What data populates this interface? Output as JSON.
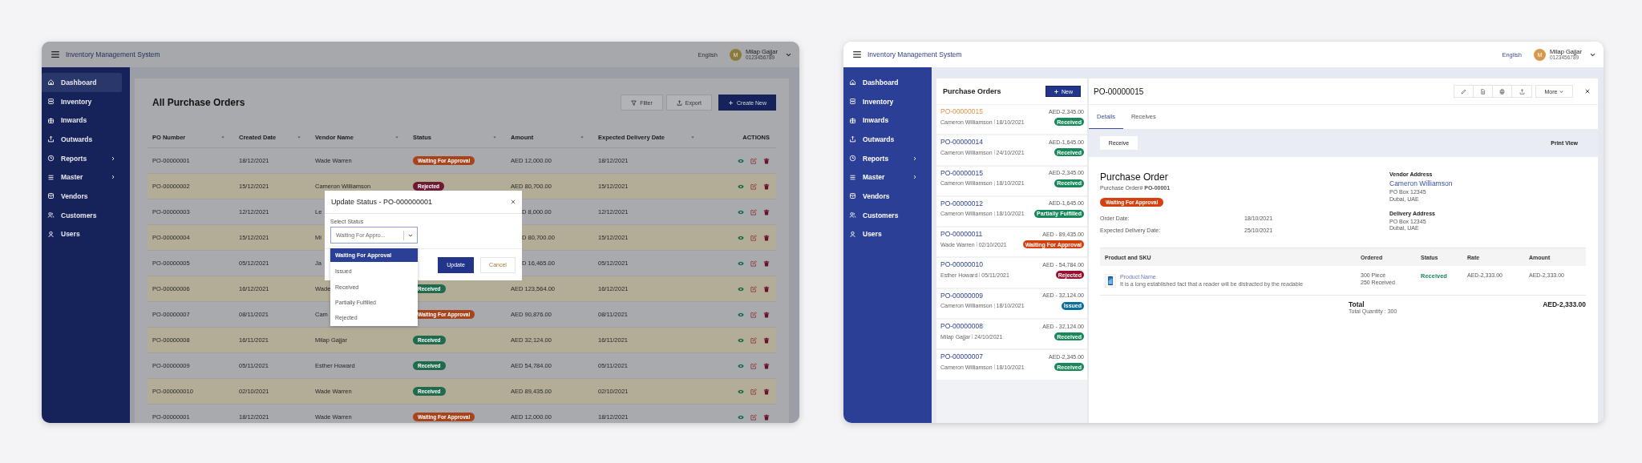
{
  "left_screen": {
    "header": {
      "app_title": "Inventory Management System",
      "language": "English",
      "user": {
        "initial": "M",
        "name": "Milap Gajjar",
        "phone": "0123456789"
      }
    },
    "sidebar": {
      "items": [
        {
          "label": "Dashboard",
          "kind": "home",
          "selected": true,
          "has_submenu": false
        },
        {
          "label": "Inventory",
          "kind": "stack",
          "selected": false,
          "has_submenu": false
        },
        {
          "label": "Inwards",
          "kind": "package",
          "selected": false,
          "has_submenu": false
        },
        {
          "label": "Outwards",
          "kind": "upload",
          "selected": false,
          "has_submenu": false
        },
        {
          "label": "Reports",
          "kind": "clock",
          "selected": false,
          "has_submenu": true
        },
        {
          "label": "Master",
          "kind": "list",
          "selected": false,
          "has_submenu": true
        },
        {
          "label": "Vendors",
          "kind": "store",
          "selected": false,
          "has_submenu": false
        },
        {
          "label": "Customers",
          "kind": "users",
          "selected": false,
          "has_submenu": false
        },
        {
          "label": "Users",
          "kind": "user",
          "selected": false,
          "has_submenu": false
        }
      ]
    },
    "page_title": "All Purchase Orders",
    "buttons": [
      {
        "label": "Filter",
        "kind": "filter"
      },
      {
        "label": "Export",
        "kind": "export"
      },
      {
        "label": "Create New",
        "kind": "create"
      }
    ],
    "table": {
      "columns": [
        {
          "label": "PO Number",
          "sortable": true
        },
        {
          "label": "Created Date",
          "sortable": true
        },
        {
          "label": "Vendor Name",
          "sortable": true
        },
        {
          "label": "Status",
          "sortable": true
        },
        {
          "label": "Amount",
          "sortable": true
        },
        {
          "label": "Expected Delivery Date",
          "sortable": true
        },
        {
          "label": "ACTIONS",
          "sortable": false
        }
      ],
      "rows": [
        {
          "po_number": "PO-00000001",
          "created_date": "18/12/2021",
          "vendor": "Wade Warren",
          "status": {
            "label": "Waiting For Approval",
            "color": "#a8431c"
          },
          "amount": "AED 12,000.00",
          "expected_date": "18/12/2021"
        },
        {
          "po_number": "PO-00000002",
          "created_date": "15/12/2021",
          "vendor": "Cameron Williamson",
          "status": {
            "label": "Rejected",
            "color": "#6e1a32"
          },
          "amount": "AED 80,700.00",
          "expected_date": "15/12/2021"
        },
        {
          "po_number": "PO-00000003",
          "created_date": "12/12/2021",
          "vendor": "Le",
          "amount": "D 8,000.00",
          "expected_date": "12/12/2021"
        },
        {
          "po_number": "PO-00000004",
          "created_date": "15/12/2021",
          "vendor": "Mi",
          "amount": "D 80,700.00",
          "expected_date": "15/12/2021"
        },
        {
          "po_number": "PO-00000005",
          "created_date": "05/12/2021",
          "vendor": "Ja",
          "amount": "D 16,465.00",
          "expected_date": "05/12/2021"
        },
        {
          "po_number": "PO-00000006",
          "created_date": "16/12/2021",
          "vendor": "Wade",
          "status": {
            "label": "Received",
            "color": "#1f6b4c"
          },
          "amount": "AED 123,564.00",
          "expected_date": "16/12/2021"
        },
        {
          "po_number": "PO-00000007",
          "created_date": "08/11/2021",
          "vendor": "Cam",
          "status": {
            "label": "Waiting For Approval",
            "color": "#a8431c"
          },
          "amount": "AED 90,876.00",
          "expected_date": "08/11/2021"
        },
        {
          "po_number": "PO-00000008",
          "created_date": "16/11/2021",
          "vendor": "Milap Gajjar",
          "status": {
            "label": "Received",
            "color": "#1f6b4c"
          },
          "amount": "AED 32,124.00",
          "expected_date": "16/11/2021"
        },
        {
          "po_number": "PO-00000009",
          "created_date": "05/11/2021",
          "vendor": "Esther Howard",
          "status": {
            "label": "Received",
            "color": "#1f6b4c"
          },
          "amount": "AED 54,784.00",
          "expected_date": "05/11/2021"
        },
        {
          "po_number": "PO-000000010",
          "created_date": "02/10/2021",
          "vendor": "Wade Warren",
          "status": {
            "label": "Received",
            "color": "#1f6b4c"
          },
          "amount": "AED 89,435.00",
          "expected_date": "02/10/2021"
        },
        {
          "po_number": "PO-00000001",
          "created_date": "18/12/2021",
          "vendor": "Wade Warren",
          "status": {
            "label": "Waiting For Approval",
            "color": "#a8431c"
          },
          "amount": "AED 12,000.00",
          "expected_date": "18/12/2021"
        }
      ]
    },
    "modal": {
      "title": "Update Status - PO-000000001",
      "field_label": "Select Status",
      "select_value": "Waiting For Appro...",
      "options": [
        {
          "label": "Waiting For Approval",
          "selected": true
        },
        {
          "label": "Issued",
          "selected": false
        },
        {
          "label": "Received",
          "selected": false
        },
        {
          "label": "Partially Fulfilled",
          "selected": false
        },
        {
          "label": "Rejected",
          "selected": false
        }
      ],
      "buttons": [
        {
          "label": "Update",
          "kind": "primary"
        },
        {
          "label": "Cancel",
          "kind": "secondary"
        }
      ]
    }
  },
  "right_screen": {
    "header": {
      "app_title": "Inventory Management System",
      "language": "English",
      "user": {
        "initial": "M",
        "name": "Milap Gajjar",
        "phone": "0123456789"
      }
    },
    "sidebar": {
      "items": [
        {
          "label": "Dashboard",
          "kind": "home",
          "selected": false,
          "has_submenu": false
        },
        {
          "label": "Inventory",
          "kind": "stack",
          "selected": false,
          "has_submenu": false
        },
        {
          "label": "Inwards",
          "kind": "package",
          "selected": false,
          "has_submenu": false
        },
        {
          "label": "Outwards",
          "kind": "upload",
          "selected": false,
          "has_submenu": false
        },
        {
          "label": "Reports",
          "kind": "clock",
          "selected": false,
          "has_submenu": true
        },
        {
          "label": "Master",
          "kind": "list",
          "selected": false,
          "has_submenu": true
        },
        {
          "label": "Vendors",
          "kind": "store",
          "selected": false,
          "has_submenu": false
        },
        {
          "label": "Customers",
          "kind": "users",
          "selected": false,
          "has_submenu": false
        },
        {
          "label": "Users",
          "kind": "user",
          "selected": false,
          "has_submenu": false
        }
      ]
    },
    "order_list": {
      "title": "Purchase Orders",
      "new_button": "New",
      "items": [
        {
          "po_number": "PO-00000015",
          "vendor": "Cameron Williamson",
          "date": "18/10/2021",
          "amount": "AED-2,345.00",
          "status": {
            "label": "Received",
            "color": "#18875a"
          },
          "selected": true
        },
        {
          "po_number": "PO-00000014",
          "vendor": "Cameron Williamson",
          "date": "24/10/2021",
          "amount": "AED-1,645.00",
          "status": {
            "label": "Received",
            "color": "#18875a"
          },
          "selected": false
        },
        {
          "po_number": "PO-00000015",
          "vendor": "Cameron Williamson",
          "date": "18/10/2021",
          "amount": "AED-2,345.00",
          "status": {
            "label": "Received",
            "color": "#18875a"
          },
          "selected": false
        },
        {
          "po_number": "PO-00000012",
          "vendor": "Cameron Williamson",
          "date": "18/10/2021",
          "amount": "AED-1,645.00",
          "status": {
            "label": "Partially Fulfilled",
            "color": "#18875a"
          },
          "selected": false
        },
        {
          "po_number": "PO-00000011",
          "vendor": "Wade Warren",
          "date": "02/10/2021",
          "amount": "AED - 89,435.00",
          "status": {
            "label": "Waiting For Approval",
            "color": "#d4400f"
          },
          "selected": false
        },
        {
          "po_number": "PO-00000010",
          "vendor": "Esther Howard",
          "date": "05/11/2021",
          "amount": "AED - 54,784.00",
          "status": {
            "label": "Rejected",
            "color": "#99102e"
          },
          "selected": false
        },
        {
          "po_number": "PO-00000009",
          "vendor": "Cameron Williamson",
          "date": "18/10/2021",
          "amount": "AED - 32,124.00",
          "status": {
            "label": "Issued",
            "color": "#0b6e98"
          },
          "selected": false
        },
        {
          "po_number": "PO-00000008",
          "vendor": "Milap Gajjar",
          "date": "24/10/2021",
          "amount": "AED - 32,124.00",
          "status": {
            "label": "Received",
            "color": "#18875a"
          },
          "selected": false
        },
        {
          "po_number": "PO-00000007",
          "vendor": "Cameron Williamson",
          "date": "18/10/2021",
          "amount": "AED-2,345.00",
          "status": {
            "label": "Received",
            "color": "#18875a"
          },
          "selected": false
        }
      ]
    },
    "detail": {
      "title": "PO-00000015",
      "more_button": "More",
      "tabs": [
        {
          "label": "Details",
          "selected": true
        },
        {
          "label": "Receives",
          "selected": false
        }
      ],
      "receive_button": "Receive",
      "print_view": "Print View",
      "heading": "Purchase Order",
      "number_line": "Purchase Order# **PO-00001**",
      "status": {
        "label": "Waiting For Approval",
        "color": "#d4400f"
      },
      "fields": [
        {
          "label": "Order Date:",
          "value": "18/10/2021"
        },
        {
          "label": "Expected Delivery Date:",
          "value": "25/10/2021"
        }
      ],
      "vendor_address": {
        "heading": "Vendor Address",
        "name": "Cameron Williamson",
        "lines": [
          "PO Box 12345",
          "Dubai, UAE"
        ]
      },
      "delivery_address": {
        "heading": "Delivery Address",
        "lines": [
          "PO Box 12345",
          "Dubai, UAE"
        ]
      },
      "items_table": {
        "columns": [
          "Product and SKU",
          "Ordered",
          "Status",
          "Rate",
          "Amount"
        ],
        "rows": [
          {
            "name": "Product Name",
            "description": "It is a long established fact that a reader will be distracted by the readable",
            "ordered": [
              "300 Piece",
              "250 Received"
            ],
            "status": {
              "label": "Received",
              "color": "#18875a"
            },
            "rate": "AED-2,333.00",
            "amount": "AED-2,333.00"
          }
        ]
      },
      "total": {
        "label": "Total",
        "quantity": "Total Quantity : 300",
        "amount": "AED-2,333.00"
      }
    }
  }
}
